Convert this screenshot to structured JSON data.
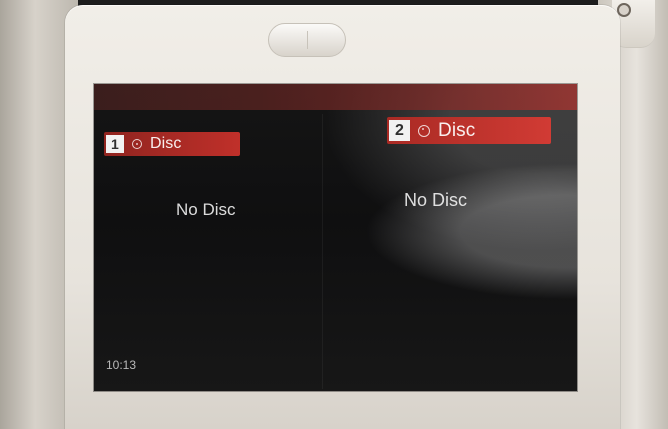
{
  "screen": {
    "left_source": {
      "number": "1",
      "label": "Disc",
      "icon": "disc-icon",
      "status": "No Disc"
    },
    "right_source": {
      "number": "2",
      "label": "Disc",
      "icon": "disc-icon",
      "status": "No Disc"
    },
    "time": "10:13",
    "accent_colors": {
      "active_tab": "#c0302a",
      "screen_background": "#111111"
    }
  }
}
